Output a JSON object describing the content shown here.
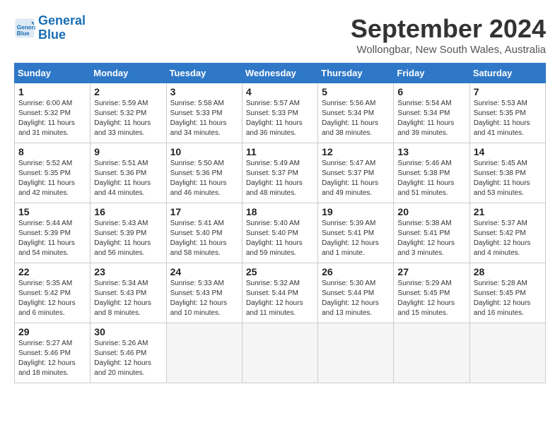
{
  "logo": {
    "line1": "General",
    "line2": "Blue"
  },
  "title": "September 2024",
  "location": "Wollongbar, New South Wales, Australia",
  "headers": [
    "Sunday",
    "Monday",
    "Tuesday",
    "Wednesday",
    "Thursday",
    "Friday",
    "Saturday"
  ],
  "weeks": [
    [
      {
        "day": "1",
        "sunrise": "6:00 AM",
        "sunset": "5:32 PM",
        "daylight": "11 hours and 31 minutes."
      },
      {
        "day": "2",
        "sunrise": "5:59 AM",
        "sunset": "5:32 PM",
        "daylight": "11 hours and 33 minutes."
      },
      {
        "day": "3",
        "sunrise": "5:58 AM",
        "sunset": "5:33 PM",
        "daylight": "11 hours and 34 minutes."
      },
      {
        "day": "4",
        "sunrise": "5:57 AM",
        "sunset": "5:33 PM",
        "daylight": "11 hours and 36 minutes."
      },
      {
        "day": "5",
        "sunrise": "5:56 AM",
        "sunset": "5:34 PM",
        "daylight": "11 hours and 38 minutes."
      },
      {
        "day": "6",
        "sunrise": "5:54 AM",
        "sunset": "5:34 PM",
        "daylight": "11 hours and 39 minutes."
      },
      {
        "day": "7",
        "sunrise": "5:53 AM",
        "sunset": "5:35 PM",
        "daylight": "11 hours and 41 minutes."
      }
    ],
    [
      {
        "day": "8",
        "sunrise": "5:52 AM",
        "sunset": "5:35 PM",
        "daylight": "11 hours and 42 minutes."
      },
      {
        "day": "9",
        "sunrise": "5:51 AM",
        "sunset": "5:36 PM",
        "daylight": "11 hours and 44 minutes."
      },
      {
        "day": "10",
        "sunrise": "5:50 AM",
        "sunset": "5:36 PM",
        "daylight": "11 hours and 46 minutes."
      },
      {
        "day": "11",
        "sunrise": "5:49 AM",
        "sunset": "5:37 PM",
        "daylight": "11 hours and 48 minutes."
      },
      {
        "day": "12",
        "sunrise": "5:47 AM",
        "sunset": "5:37 PM",
        "daylight": "11 hours and 49 minutes."
      },
      {
        "day": "13",
        "sunrise": "5:46 AM",
        "sunset": "5:38 PM",
        "daylight": "11 hours and 51 minutes."
      },
      {
        "day": "14",
        "sunrise": "5:45 AM",
        "sunset": "5:38 PM",
        "daylight": "11 hours and 53 minutes."
      }
    ],
    [
      {
        "day": "15",
        "sunrise": "5:44 AM",
        "sunset": "5:39 PM",
        "daylight": "11 hours and 54 minutes."
      },
      {
        "day": "16",
        "sunrise": "5:43 AM",
        "sunset": "5:39 PM",
        "daylight": "11 hours and 56 minutes."
      },
      {
        "day": "17",
        "sunrise": "5:41 AM",
        "sunset": "5:40 PM",
        "daylight": "11 hours and 58 minutes."
      },
      {
        "day": "18",
        "sunrise": "5:40 AM",
        "sunset": "5:40 PM",
        "daylight": "11 hours and 59 minutes."
      },
      {
        "day": "19",
        "sunrise": "5:39 AM",
        "sunset": "5:41 PM",
        "daylight": "12 hours and 1 minute."
      },
      {
        "day": "20",
        "sunrise": "5:38 AM",
        "sunset": "5:41 PM",
        "daylight": "12 hours and 3 minutes."
      },
      {
        "day": "21",
        "sunrise": "5:37 AM",
        "sunset": "5:42 PM",
        "daylight": "12 hours and 4 minutes."
      }
    ],
    [
      {
        "day": "22",
        "sunrise": "5:35 AM",
        "sunset": "5:42 PM",
        "daylight": "12 hours and 6 minutes."
      },
      {
        "day": "23",
        "sunrise": "5:34 AM",
        "sunset": "5:43 PM",
        "daylight": "12 hours and 8 minutes."
      },
      {
        "day": "24",
        "sunrise": "5:33 AM",
        "sunset": "5:43 PM",
        "daylight": "12 hours and 10 minutes."
      },
      {
        "day": "25",
        "sunrise": "5:32 AM",
        "sunset": "5:44 PM",
        "daylight": "12 hours and 11 minutes."
      },
      {
        "day": "26",
        "sunrise": "5:30 AM",
        "sunset": "5:44 PM",
        "daylight": "12 hours and 13 minutes."
      },
      {
        "day": "27",
        "sunrise": "5:29 AM",
        "sunset": "5:45 PM",
        "daylight": "12 hours and 15 minutes."
      },
      {
        "day": "28",
        "sunrise": "5:28 AM",
        "sunset": "5:45 PM",
        "daylight": "12 hours and 16 minutes."
      }
    ],
    [
      {
        "day": "29",
        "sunrise": "5:27 AM",
        "sunset": "5:46 PM",
        "daylight": "12 hours and 18 minutes."
      },
      {
        "day": "30",
        "sunrise": "5:26 AM",
        "sunset": "5:46 PM",
        "daylight": "12 hours and 20 minutes."
      },
      null,
      null,
      null,
      null,
      null
    ]
  ]
}
